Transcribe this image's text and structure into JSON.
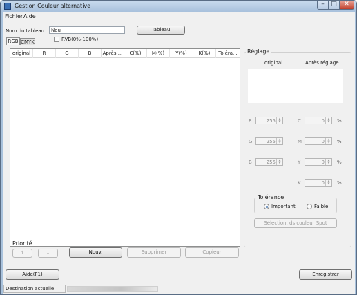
{
  "window": {
    "title": "Gestion Couleur alternative"
  },
  "menu": [
    {
      "underlined": "F",
      "rest": "ichier"
    },
    {
      "underlined": "A",
      "rest": "ide"
    }
  ],
  "table_name": {
    "label": "Nom du tableau",
    "value": "Neu",
    "button": "Tableau"
  },
  "tabs": [
    "RGB",
    "CMYK"
  ],
  "rvb_checkbox": {
    "label": "RVB(0%-100%)",
    "checked": false
  },
  "grid": {
    "columns": [
      "original",
      "R",
      "G",
      "B",
      "Après ...",
      "C(%)",
      "M(%)",
      "Y(%)",
      "K(%)",
      "Toléra..."
    ]
  },
  "priority": {
    "title": "Priorité",
    "up": "↑",
    "down": "↓"
  },
  "actions": {
    "new": "Nouv.",
    "delete": "Supprimer",
    "copy": "Copieur"
  },
  "reglage": {
    "title": "Réglage",
    "col_original": "original",
    "col_after": "Après réglage",
    "rgb": [
      {
        "label": "R",
        "value": "255"
      },
      {
        "label": "G",
        "value": "255"
      },
      {
        "label": "B",
        "value": "255"
      }
    ],
    "cmyk": [
      {
        "label": "C",
        "value": "0",
        "unit": "%"
      },
      {
        "label": "M",
        "value": "0",
        "unit": "%"
      },
      {
        "label": "Y",
        "value": "0",
        "unit": "%"
      },
      {
        "label": "K",
        "value": "0",
        "unit": "%"
      }
    ],
    "tolerance": {
      "title": "Tolérance",
      "important": "Important",
      "faible": "Faible",
      "selected": "Important"
    },
    "spot_button": "Sélection. ds couleur Spot"
  },
  "bottom": {
    "help": "Aide(F1)",
    "save": "Enregistrer"
  },
  "status": {
    "text": "Destination actuelle"
  }
}
